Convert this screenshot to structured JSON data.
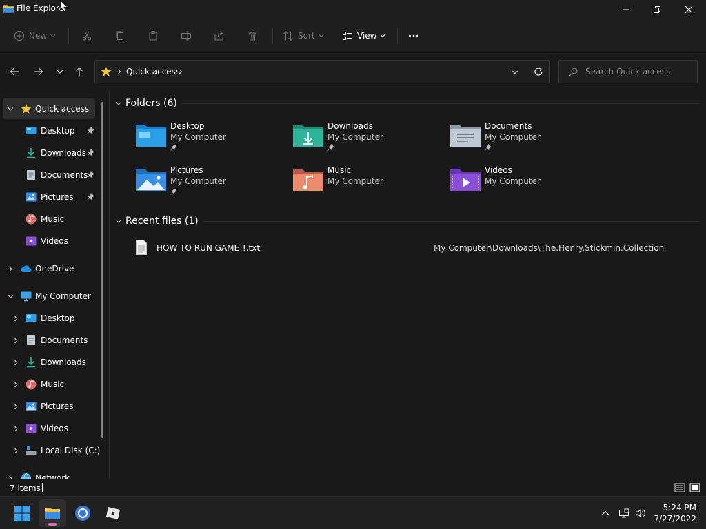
{
  "window": {
    "title": "File Explorer"
  },
  "toolbar": {
    "new_label": "New",
    "sort_label": "Sort",
    "view_label": "View"
  },
  "address": {
    "location": "Quick access"
  },
  "search": {
    "placeholder": "Search Quick access"
  },
  "sidebar": {
    "quick_access": "Quick access",
    "pinned": [
      "Desktop",
      "Downloads",
      "Documents",
      "Pictures",
      "Music",
      "Videos"
    ],
    "onedrive": "OneDrive",
    "my_computer": "My Computer",
    "computer_items": [
      "Desktop",
      "Documents",
      "Downloads",
      "Music",
      "Pictures",
      "Videos",
      "Local Disk (C:)"
    ],
    "network": "Network"
  },
  "folders": {
    "heading": "Folders (6)",
    "items": [
      {
        "name": "Desktop",
        "location": "My Computer"
      },
      {
        "name": "Downloads",
        "location": "My Computer"
      },
      {
        "name": "Documents",
        "location": "My Computer"
      },
      {
        "name": "Pictures",
        "location": "My Computer"
      },
      {
        "name": "Music",
        "location": "My Computer"
      },
      {
        "name": "Videos",
        "location": "My Computer"
      }
    ]
  },
  "recent": {
    "heading": "Recent files (1)",
    "items": [
      {
        "name": "HOW TO RUN GAME!!.txt",
        "path": "My Computer\\Downloads\\The.Henry.Stickmin.Collection"
      }
    ]
  },
  "status": {
    "items_count": "7 items"
  },
  "clock": {
    "time": "5:24 PM",
    "date": "7/27/2022"
  },
  "colors": {
    "background": "#191919",
    "panel": "#1f1f1f",
    "folder_blue": "#2b9fe8",
    "folder_green": "#2fb39a",
    "accent_pink": "#d36fb0"
  }
}
